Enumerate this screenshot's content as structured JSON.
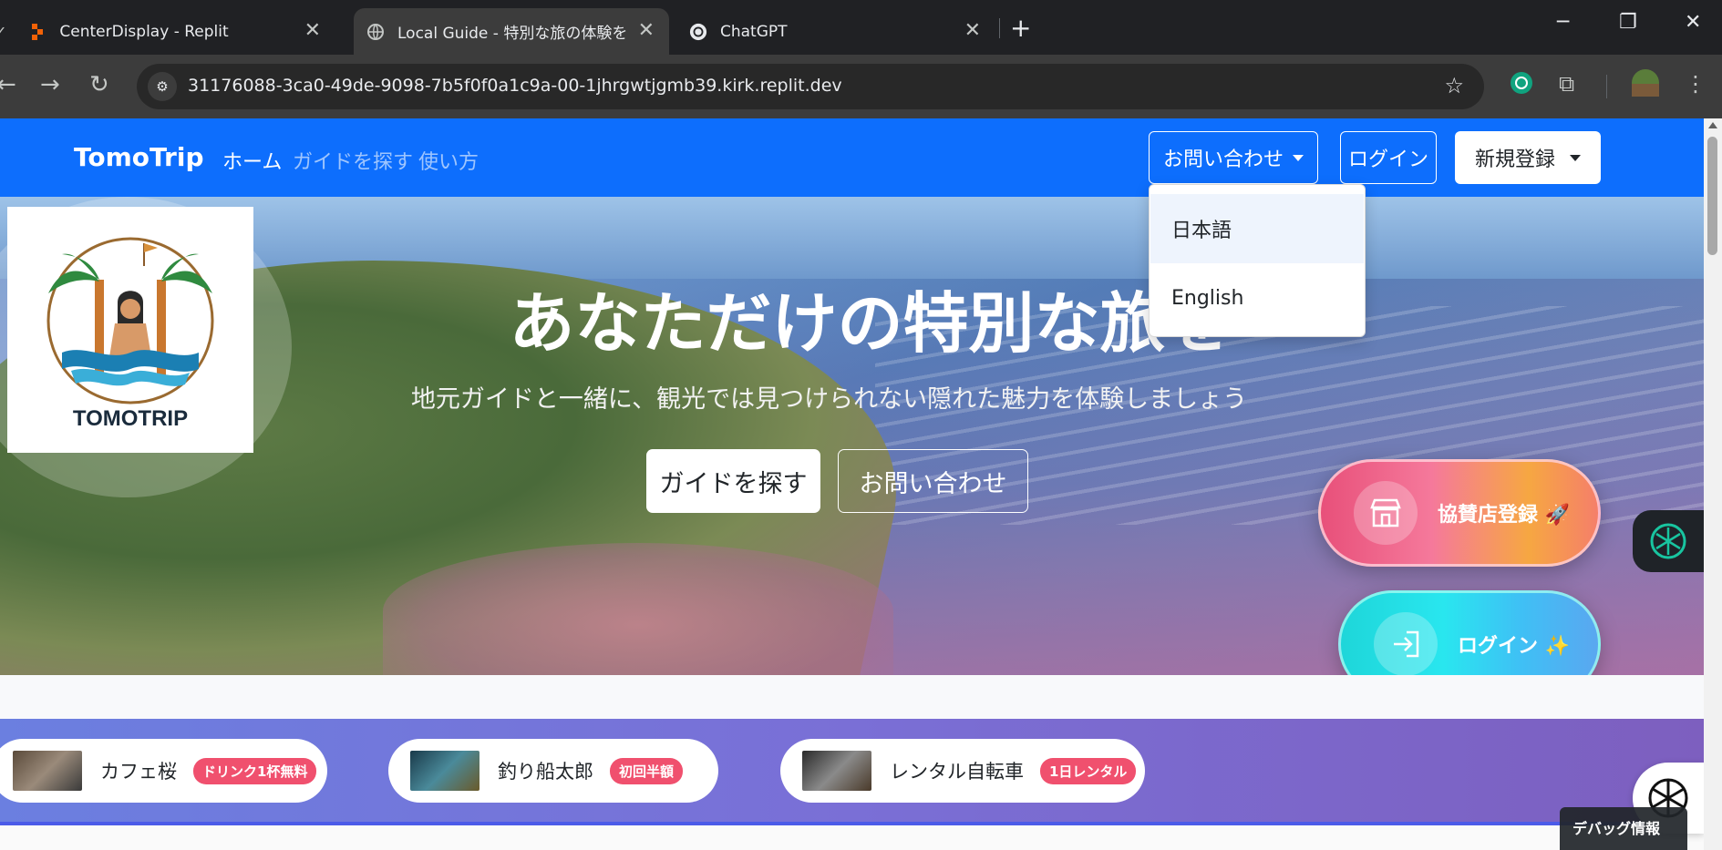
{
  "browser": {
    "tabs": [
      {
        "title": "CenterDisplay - Replit"
      },
      {
        "title": "Local Guide - 特別な旅の体験を"
      },
      {
        "title": "ChatGPT"
      }
    ],
    "url": "31176088-3ca0-49de-9098-7b5f0f0a1c9a-00-1jhrgwtjgmb39.kirk.replit.dev"
  },
  "navbar": {
    "brand": "TomoTrip",
    "links": [
      "ホーム",
      "ガイドを探す",
      "使い方"
    ],
    "contact_label": "お問い合わせ",
    "login_label": "ログイン",
    "register_label": "新規登録"
  },
  "dropdown": {
    "items": [
      "日本語",
      "English"
    ]
  },
  "hero": {
    "logo_text": "TOMOTRIP",
    "title": "あなただけの特別な旅を",
    "subtitle": "地元ガイドと一緒に、観光では見つけられない隠れた魅力を体験しましょう",
    "find_guide_label": "ガイドを探す",
    "contact_label": "お問い合わせ"
  },
  "fabs": {
    "sponsor_label": "協賛店登録 🚀",
    "login_label": "ログイン ✨"
  },
  "sponsors": [
    {
      "name": "カフェ桜",
      "badge": "ドリンク1杯無料"
    },
    {
      "name": "釣り船太郎",
      "badge": "初回半額"
    },
    {
      "name": "レンタル自転車",
      "badge": "1日レンタル"
    }
  ],
  "debug": {
    "label": "デバッグ情報"
  },
  "colors": {
    "navbar": "#0d6efd",
    "badge": "#f0506e",
    "strip_start": "#6b7fe0",
    "strip_end": "#7d5fbf"
  }
}
